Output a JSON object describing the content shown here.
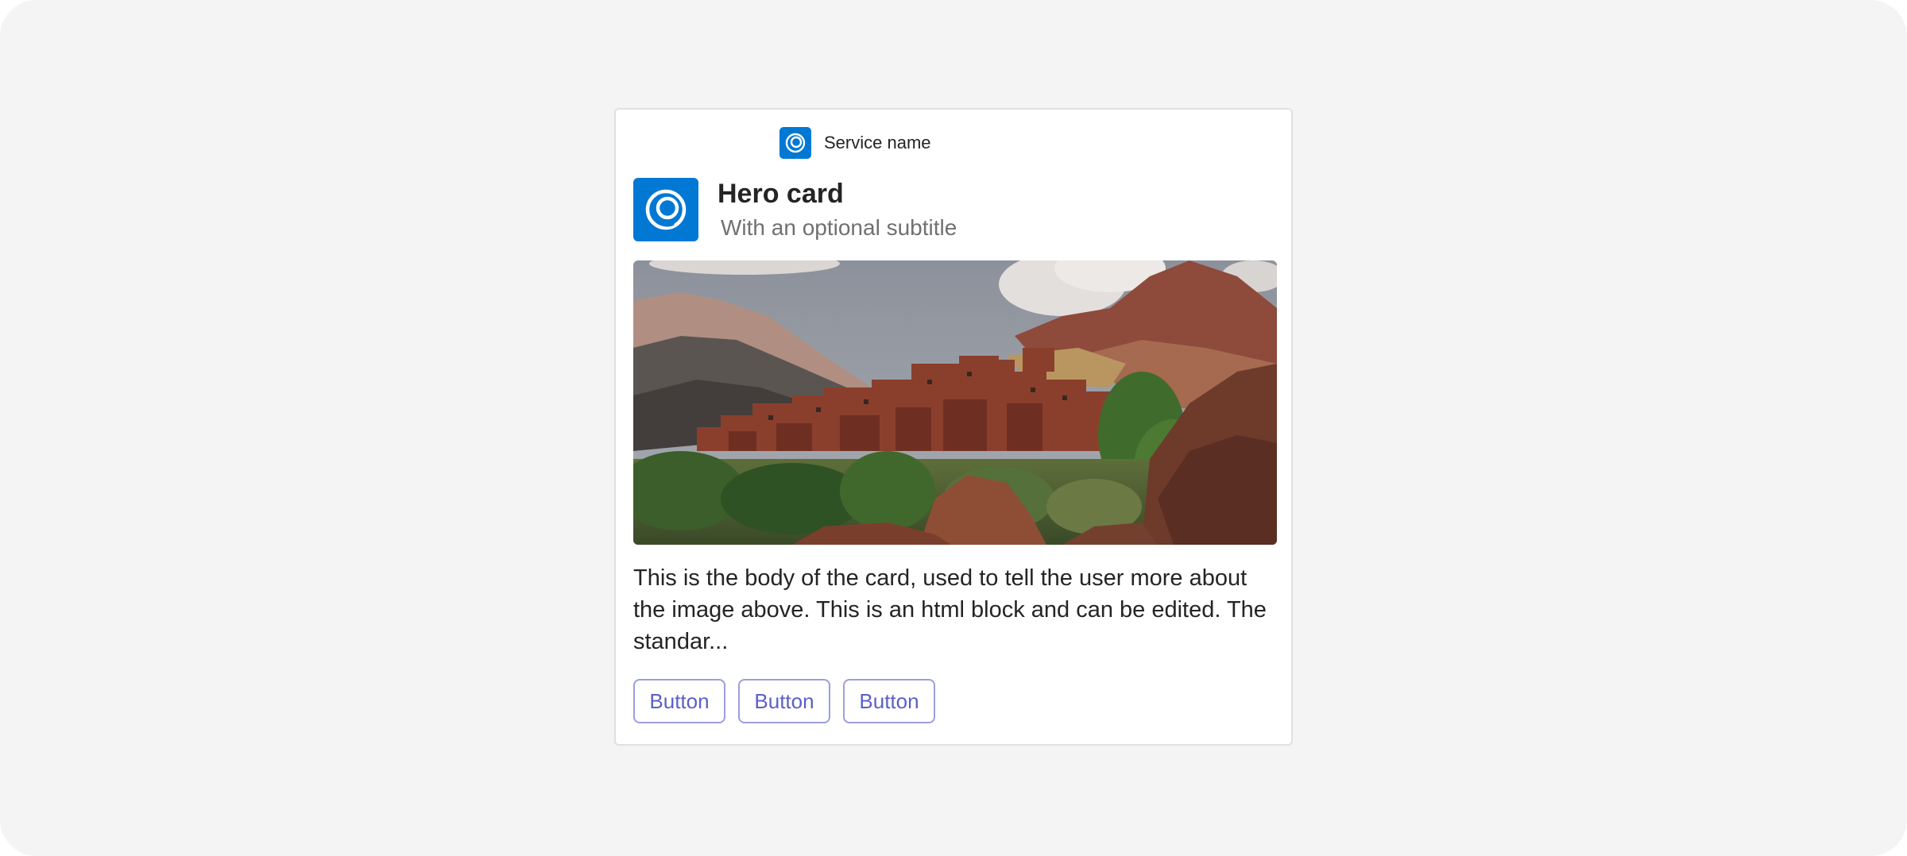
{
  "service": {
    "name": "Service name",
    "icon": "service-logo-icon"
  },
  "card": {
    "icon": "app-logo-icon",
    "title": "Hero card",
    "subtitle": "With an optional subtitle",
    "image": "mountain-village-photo",
    "body": "This is the body of the card, used to tell the user more about the image above. This is an html block and can be edited. The standar...",
    "buttons": [
      {
        "label": "Button"
      },
      {
        "label": "Button"
      },
      {
        "label": "Button"
      }
    ]
  },
  "colors": {
    "brand": "#0078d4",
    "button_text": "#5b5fc7",
    "button_border": "#9b9fdc",
    "background": "#f4f4f4"
  }
}
